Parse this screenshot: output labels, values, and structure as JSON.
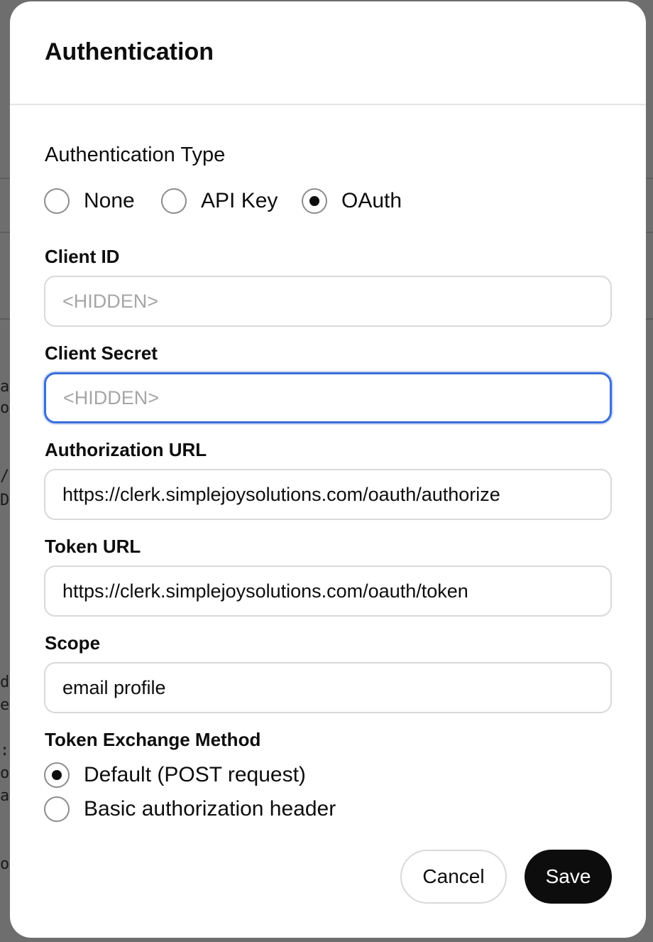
{
  "background": {
    "fragments": [
      "ar",
      "o:",
      "/g",
      "D",
      "d",
      "et",
      ":",
      "of",
      "ai",
      "of"
    ]
  },
  "modal": {
    "title": "Authentication",
    "auth_type": {
      "label": "Authentication Type",
      "options": [
        "None",
        "API Key",
        "OAuth"
      ],
      "selected": "OAuth"
    },
    "client_id": {
      "label": "Client ID",
      "placeholder": "<HIDDEN>",
      "value": ""
    },
    "client_secret": {
      "label": "Client Secret",
      "placeholder": "<HIDDEN>",
      "value": ""
    },
    "authorization_url": {
      "label": "Authorization URL",
      "value": "https://clerk.simplejoysolutions.com/oauth/authorize"
    },
    "token_url": {
      "label": "Token URL",
      "value": "https://clerk.simplejoysolutions.com/oauth/token"
    },
    "scope": {
      "label": "Scope",
      "value": "email profile"
    },
    "token_exchange": {
      "label": "Token Exchange Method",
      "options": [
        "Default (POST request)",
        "Basic authorization header"
      ],
      "selected": "Default (POST request)"
    },
    "buttons": {
      "cancel": "Cancel",
      "save": "Save"
    }
  },
  "colors": {
    "focus_ring": "#3b6fd8",
    "primary_button": "#0d0d0d"
  }
}
